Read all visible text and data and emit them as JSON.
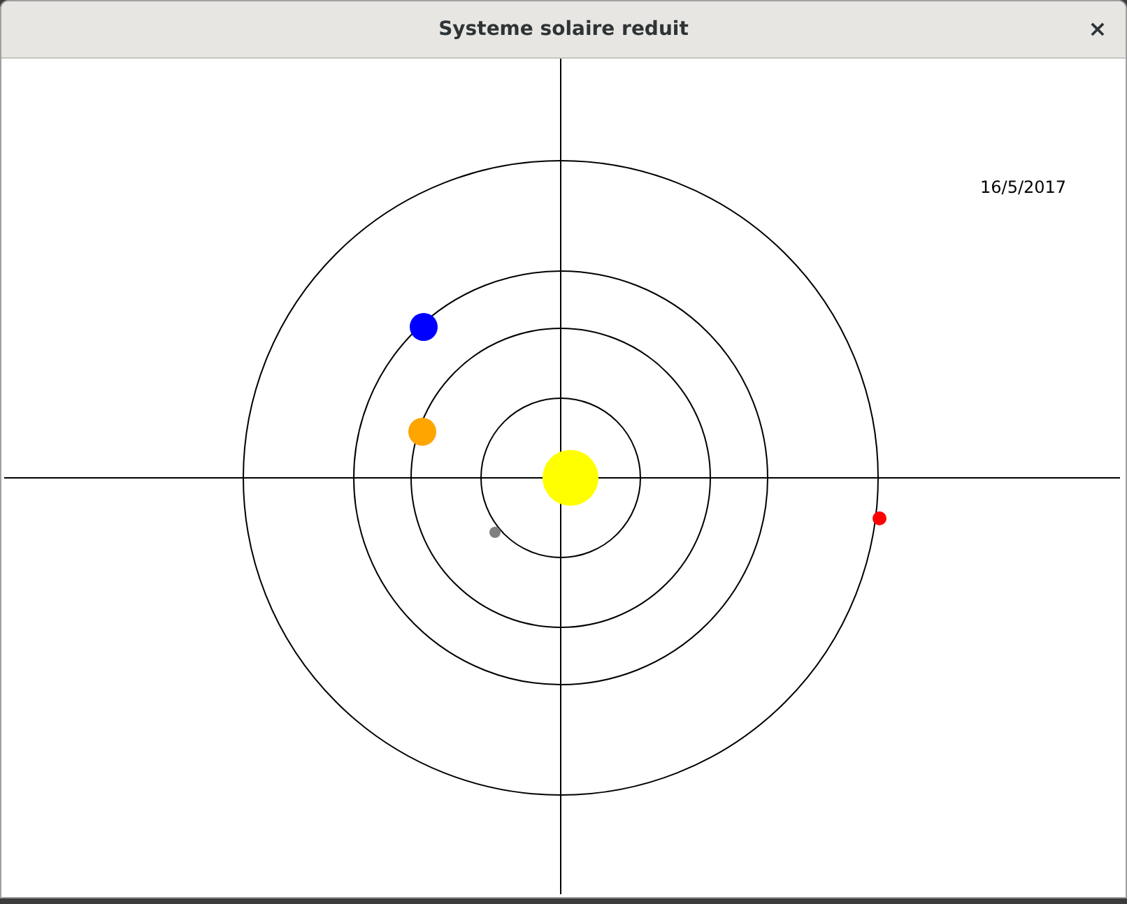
{
  "window": {
    "title": "Systeme solaire reduit",
    "close": "×"
  },
  "date": "16/5/2017",
  "sun": {
    "color": "#ffff00"
  },
  "planets": [
    {
      "color": "#808080"
    },
    {
      "color": "#ffa500"
    },
    {
      "color": "#0000ff"
    },
    {
      "color": "#ff0000"
    }
  ]
}
